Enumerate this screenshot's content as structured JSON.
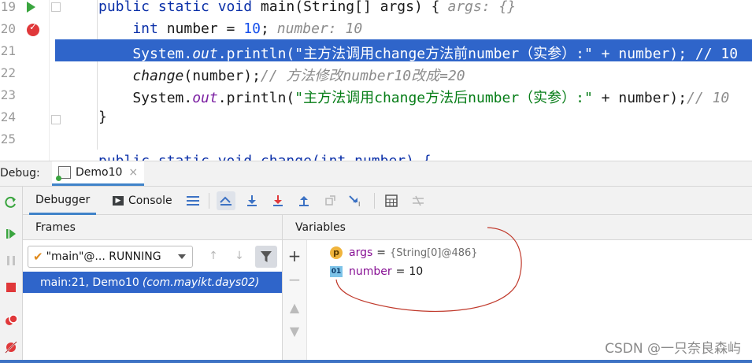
{
  "editor": {
    "lines": [
      {
        "no": "19",
        "parts": [
          {
            "t": "public static void ",
            "c": "kw"
          },
          {
            "t": "main(String[] args) {",
            "c": ""
          },
          {
            "t": "args: {}",
            "c": "hint"
          }
        ]
      },
      {
        "no": "20",
        "parts": [
          {
            "t": "    int ",
            "c": "kw"
          },
          {
            "t": "number = ",
            "c": ""
          },
          {
            "t": "10",
            "c": "num"
          },
          {
            "t": ";",
            "c": ""
          },
          {
            "t": "number: 10",
            "c": "hint"
          }
        ]
      },
      {
        "no": "21",
        "parts": [
          {
            "t": "    System.",
            "c": ""
          },
          {
            "t": "out",
            "c": "fld"
          },
          {
            "t": ".println(",
            "c": ""
          },
          {
            "t": "\"主方法调用change方法前number（实参）:\"",
            "c": "str"
          },
          {
            "t": " + number); // 10",
            "c": ""
          }
        ]
      },
      {
        "no": "22",
        "parts": [
          {
            "t": "    change",
            "c": "ital"
          },
          {
            "t": "(number);",
            "c": ""
          },
          {
            "t": "// 方法修改number10改成=20",
            "c": "cmt"
          }
        ]
      },
      {
        "no": "23",
        "parts": [
          {
            "t": "    System.",
            "c": ""
          },
          {
            "t": "out",
            "c": "fld"
          },
          {
            "t": ".println(",
            "c": ""
          },
          {
            "t": "\"主方法调用change方法后number（实参）:\"",
            "c": "str"
          },
          {
            "t": " + number);",
            "c": ""
          },
          {
            "t": "// 10",
            "c": "cmt"
          }
        ]
      },
      {
        "no": "24",
        "parts": [
          {
            "t": "}",
            "c": ""
          }
        ]
      },
      {
        "no": "25",
        "parts": [
          {
            "t": "",
            "c": ""
          }
        ]
      },
      {
        "no": "",
        "parts": [
          {
            "t": "public static void change(int number) {",
            "c": "kw"
          }
        ]
      }
    ]
  },
  "debug": {
    "label": "Debug:",
    "tab_label": "Demo10",
    "tab_close": "×"
  },
  "toolbar": {
    "debugger_tab": "Debugger",
    "console_tab": "Console"
  },
  "frames": {
    "title": "Frames",
    "thread_label": "\"main\"@... RUNNING",
    "frame_text": "main:21, Demo10",
    "frame_package": "(com.mayikt.days02)"
  },
  "variables": {
    "title": "Variables",
    "items": [
      {
        "icon": "p",
        "name": "args",
        "eq": "=",
        "value": "{String[0]@486}"
      },
      {
        "icon": "01",
        "name": "number",
        "eq": "=",
        "value": "10"
      }
    ]
  },
  "watermark": "CSDN @一只奈良森屿",
  "colors": {
    "selection": "#2f65ca",
    "tab_underline": "#4083c9",
    "keyword": "#0a2fa8",
    "string": "#067d17",
    "annotation": "#c0392b"
  }
}
